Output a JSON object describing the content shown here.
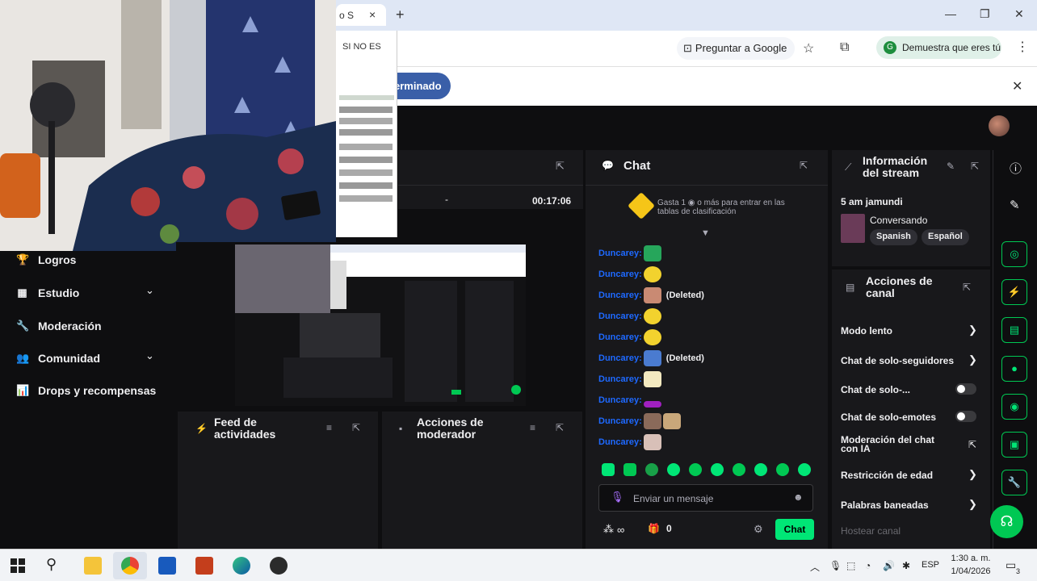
{
  "browser": {
    "tab_title": "o S",
    "tab_close": "×",
    "new_tab": "+",
    "window_controls": [
      "—",
      "❐",
      "✕"
    ],
    "ask_google": "Preguntar a Google",
    "verify_label": "Demuestra que eres tú",
    "verify_initial": "G",
    "done_button": "erminado",
    "infobar_close": "✕"
  },
  "popup": {
    "text": "SI NO ES"
  },
  "sidebar": {
    "items": [
      {
        "label": "Logros",
        "icon": "trophy-icon",
        "glyph": "🏆"
      },
      {
        "label": "Estudio",
        "icon": "studio-icon",
        "glyph": "▦",
        "chevron": "⌄"
      },
      {
        "label": "Moderación",
        "icon": "wrench-icon",
        "glyph": "🔧"
      },
      {
        "label": "Comunidad",
        "icon": "community-icon",
        "glyph": "👥",
        "chevron": "⌄"
      },
      {
        "label": "Drops y recompensas",
        "icon": "drops-icon",
        "glyph": "📊"
      }
    ]
  },
  "video": {
    "time": "00:17:06",
    "dash": "-"
  },
  "panels": {
    "activity_feed": "Feed de actividades",
    "mod_actions": "Acciones de moderador"
  },
  "chat": {
    "title": "Chat",
    "leaderboard_text": "Gasta 1 ◉ o más para entrar en las tablas de clasificación",
    "messages": [
      {
        "user": "Duncarey:",
        "deleted": ""
      },
      {
        "user": "Duncarey:",
        "deleted": ""
      },
      {
        "user": "Duncarey:",
        "deleted": "(Deleted)"
      },
      {
        "user": "Duncarey:",
        "deleted": ""
      },
      {
        "user": "Duncarey:",
        "deleted": ""
      },
      {
        "user": "Duncarey:",
        "deleted": "(Deleted)"
      },
      {
        "user": "Duncarey:",
        "deleted": ""
      },
      {
        "user": "Duncarey:",
        "deleted": ""
      },
      {
        "user": "Duncarey:",
        "deleted": ""
      },
      {
        "user": "Duncarey:",
        "deleted": ""
      }
    ],
    "input_placeholder": "Enviar un mensaje",
    "points": "∞",
    "gifts": "0",
    "send_label": "Chat"
  },
  "stream_info": {
    "title": "Información del stream",
    "stream_title": "5 am jamundi",
    "category": "Conversando",
    "tags": [
      "Spanish",
      "Español"
    ]
  },
  "channel_actions": {
    "title": "Acciones de canal",
    "items": [
      {
        "label": "Modo lento",
        "control": "chevron"
      },
      {
        "label": "Chat de solo-seguidores",
        "control": "chevron"
      },
      {
        "label": "Chat de solo-...",
        "control": "toggle"
      },
      {
        "label": "Chat de solo-emotes",
        "control": "toggle"
      },
      {
        "label": "Moderación del chat con IA",
        "control": "external"
      },
      {
        "label": "Restricción de edad",
        "control": "chevron"
      },
      {
        "label": "Palabras baneadas",
        "control": "chevron"
      },
      {
        "label": "Hostear canal",
        "control": "none"
      }
    ]
  },
  "taskbar": {
    "language": "ESP",
    "time": "1:30 a. m.",
    "date": "1/04/2026",
    "notification_count": "3"
  },
  "colors": {
    "accent_green": "#00e676",
    "twitch_bg": "#0e0e10",
    "panel_bg": "#18181b",
    "username_blue": "#1e69ff"
  }
}
